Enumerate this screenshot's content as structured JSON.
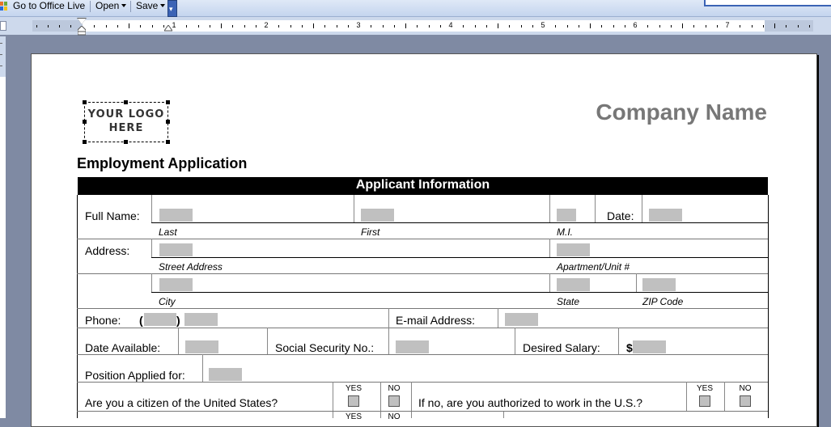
{
  "toolbar": {
    "office_live_label": "Go to Office Live",
    "open_label": "Open",
    "save_label": "Save"
  },
  "ruler": {
    "numbers": [
      "1",
      "2",
      "3",
      "4",
      "5",
      "6",
      "7"
    ]
  },
  "document": {
    "logo_text": "YOUR LOGO HERE",
    "company_name": "Company Name",
    "title": "Employment Application",
    "section_title": "Applicant Information",
    "labels": {
      "full_name": "Full Name:",
      "date": "Date:",
      "address": "Address:",
      "phone": "Phone:",
      "phone_open": "(",
      "phone_close": ")",
      "email": "E-mail Address:",
      "date_available": "Date Available:",
      "ssn": "Social Security No.:",
      "desired_salary": "Desired Salary:",
      "salary_symbol": "$",
      "position": "Position Applied for:",
      "citizen": "Are you a citizen of the United States?",
      "authorized": "If no, are you authorized to work in the U.S.?",
      "yes": "YES",
      "no": "NO"
    },
    "sublabels": {
      "last": "Last",
      "first": "First",
      "mi": "M.I.",
      "street": "Street Address",
      "apartment": "Apartment/Unit #",
      "city": "City",
      "state": "State",
      "zip": "ZIP Code"
    }
  },
  "colors": {
    "section_bar": "#000000",
    "field_fill": "#c0c0c0",
    "company_name": "#777777"
  }
}
